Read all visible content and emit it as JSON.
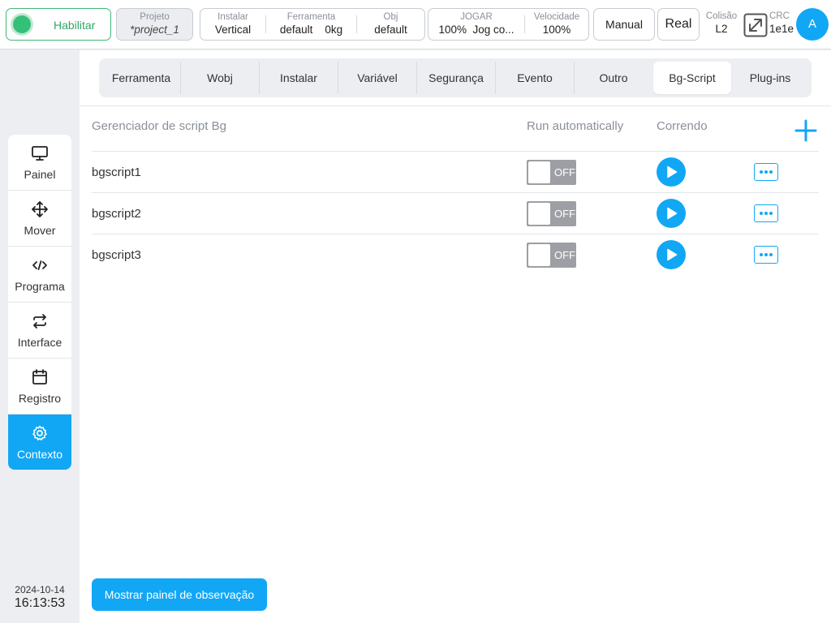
{
  "topbar": {
    "enable_label": "Habilitar",
    "project": {
      "label": "Projeto",
      "value": "*project_1"
    },
    "install": {
      "label": "Instalar",
      "value": "Vertical"
    },
    "tool": {
      "label": "Ferramenta",
      "value": "default",
      "weight": "0kg"
    },
    "obj": {
      "label": "Obj",
      "value": "default"
    },
    "jog": {
      "label": "JOGAR",
      "value": "100%",
      "mode": "Jog co..."
    },
    "speed": {
      "label": "Velocidade",
      "value": "100%"
    },
    "manual_label": "Manual",
    "real_label": "Real",
    "collision": {
      "label": "Colisão",
      "value": "L2"
    },
    "crc": {
      "label": "CRC",
      "value": "1e1e"
    },
    "avatar_letter": "A",
    "expand_icon": "expand-icon"
  },
  "sidebar": {
    "items": [
      {
        "label": "Painel",
        "icon": "monitor-icon"
      },
      {
        "label": "Mover",
        "icon": "move-arrows-icon"
      },
      {
        "label": "Programa",
        "icon": "code-icon"
      },
      {
        "label": "Interface",
        "icon": "swap-icon"
      },
      {
        "label": "Registro",
        "icon": "calendar-icon"
      },
      {
        "label": "Contexto",
        "icon": "gear-icon",
        "active": true
      }
    ],
    "date": "2024-10-14",
    "time": "16:13:53"
  },
  "tabs": [
    {
      "label": "Ferramenta"
    },
    {
      "label": "Wobj"
    },
    {
      "label": "Instalar"
    },
    {
      "label": "Variável"
    },
    {
      "label": "Segurança"
    },
    {
      "label": "Evento"
    },
    {
      "label": "Outro"
    },
    {
      "label": "Bg-Script",
      "active": true
    },
    {
      "label": "Plug-ins"
    }
  ],
  "table": {
    "headers": {
      "name": "Gerenciador de script Bg",
      "auto": "Run automatically",
      "running": "Correndo"
    },
    "rows": [
      {
        "name": "bgscript1",
        "auto": "OFF"
      },
      {
        "name": "bgscript2",
        "auto": "OFF"
      },
      {
        "name": "bgscript3",
        "auto": "OFF"
      }
    ]
  },
  "footer": {
    "watch_button": "Mostrar painel de observação"
  },
  "colors": {
    "accent": "#11a7f5",
    "enable_green": "#35c07a",
    "toggle_off": "#9d9fa4"
  }
}
